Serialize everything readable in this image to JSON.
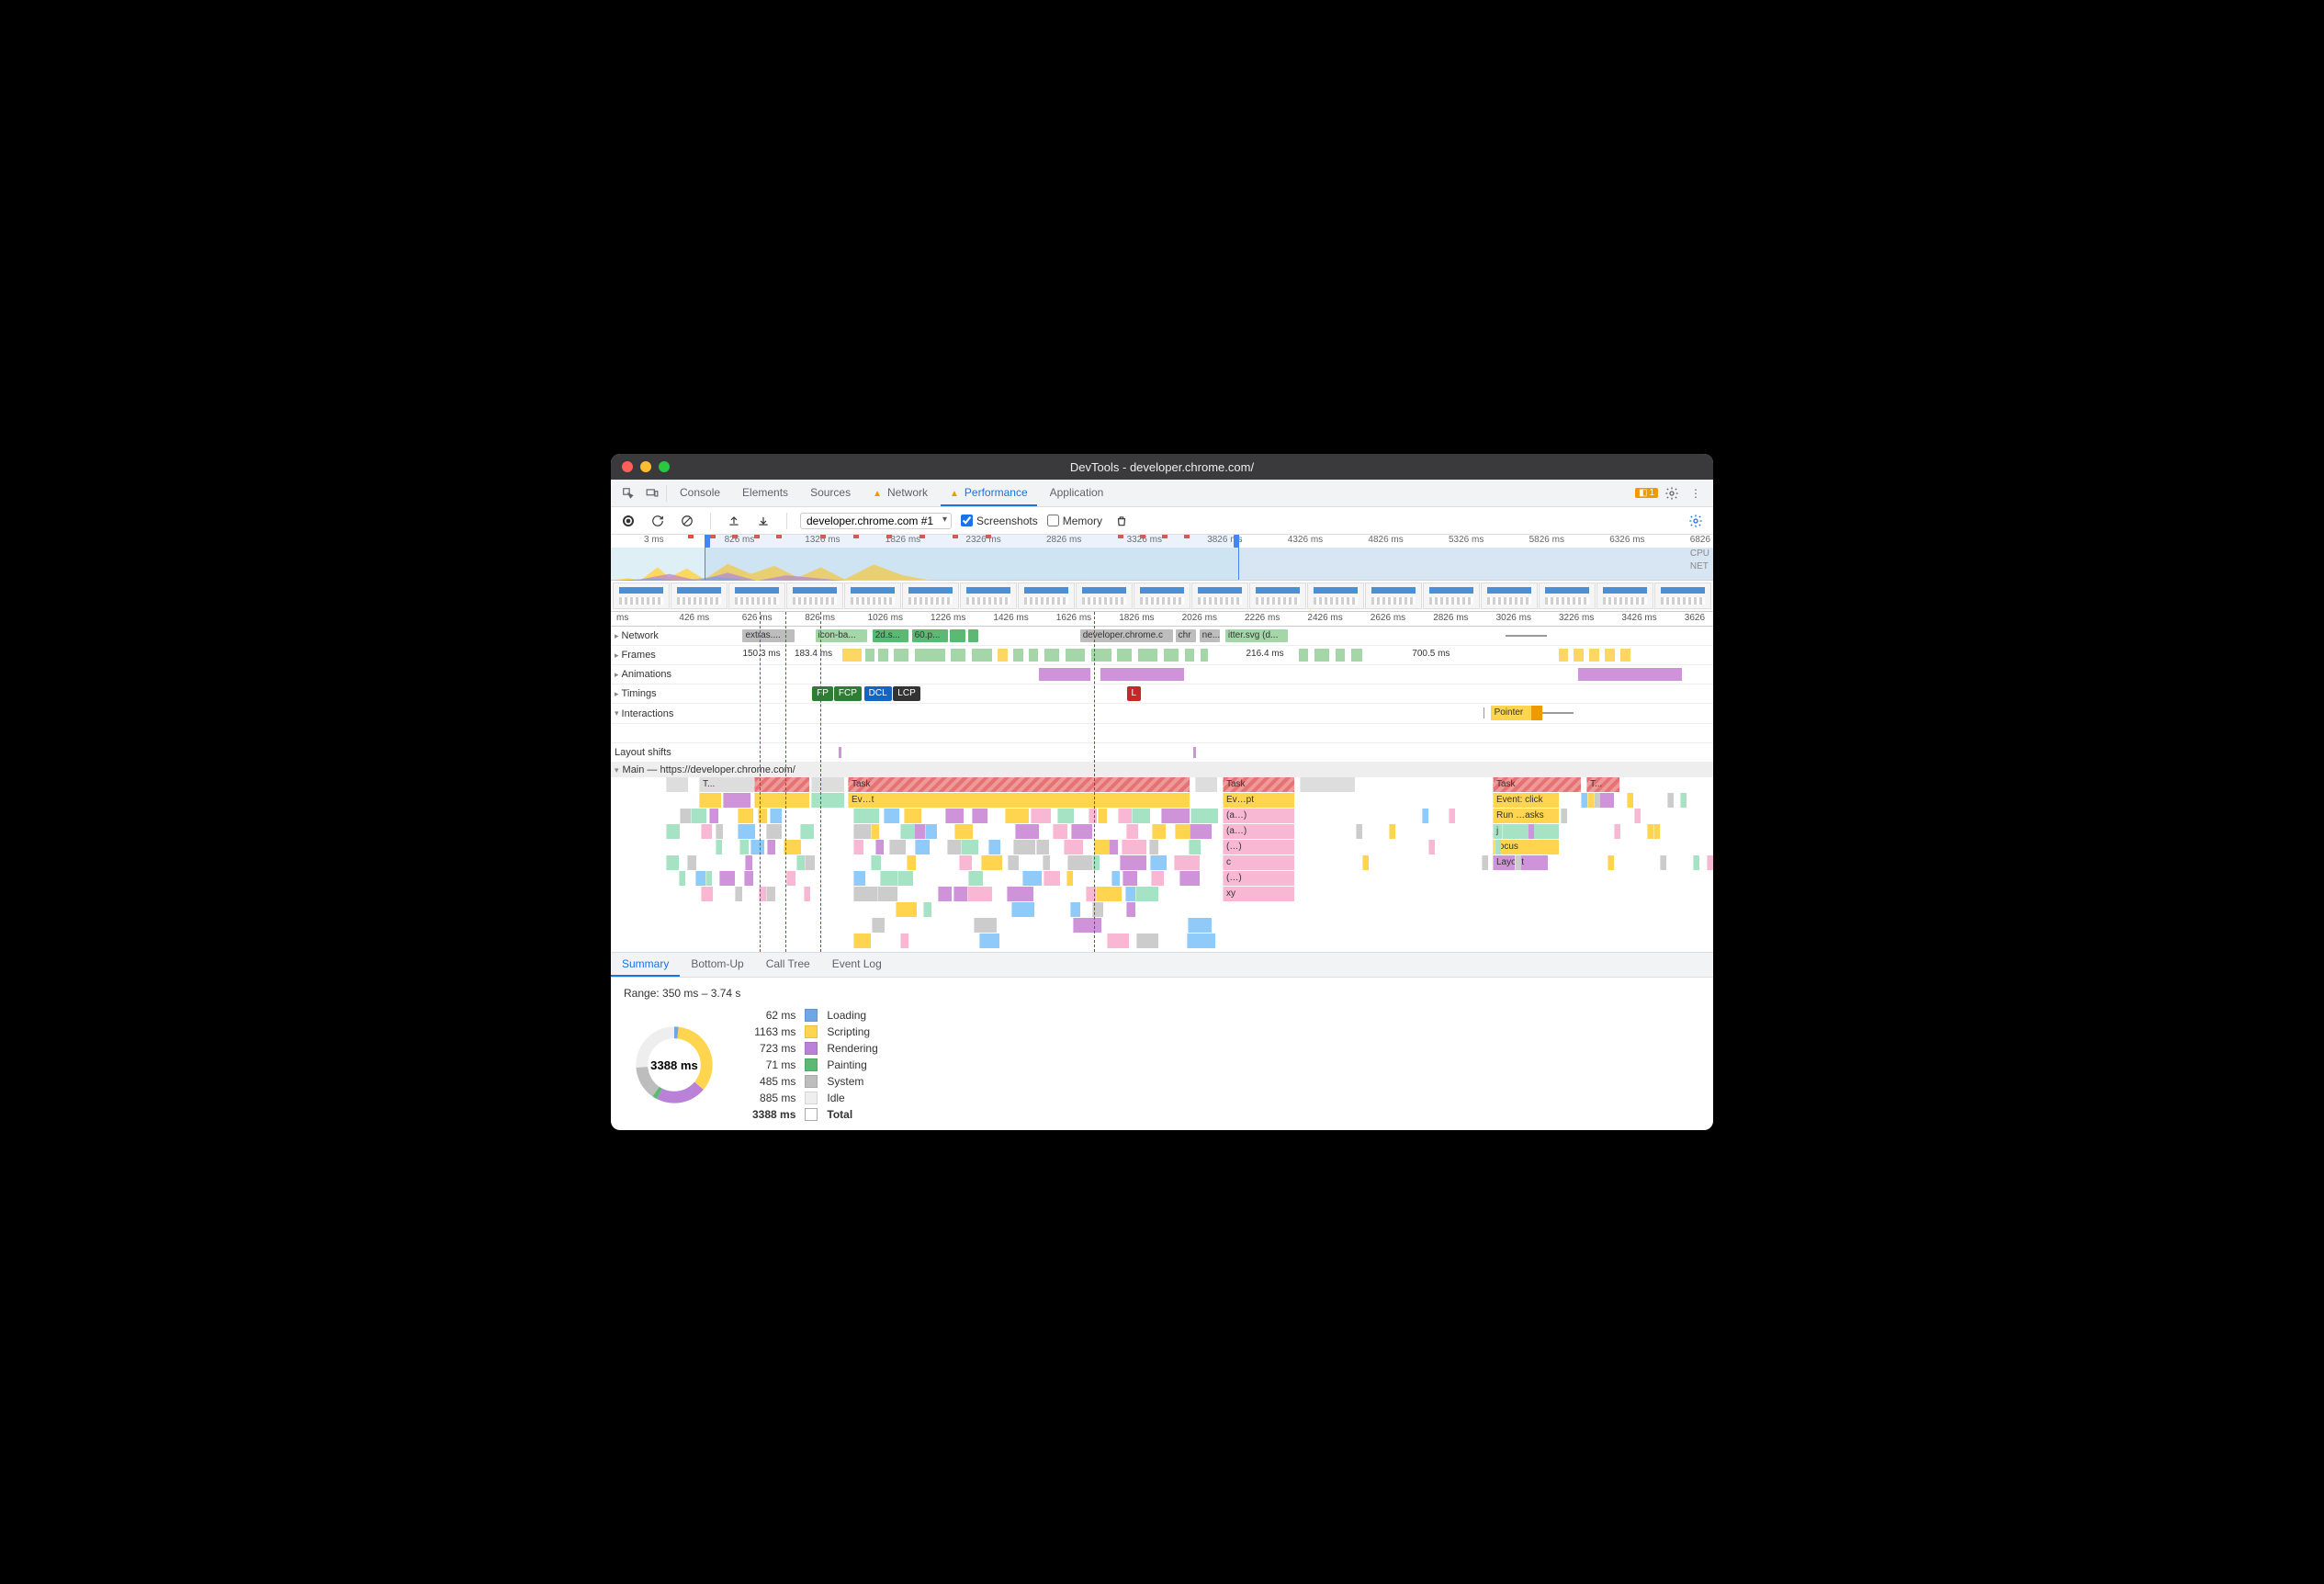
{
  "window": {
    "title": "DevTools - developer.chrome.com/"
  },
  "tabs": {
    "items": [
      "Console",
      "Elements",
      "Sources",
      "Network",
      "Performance",
      "Application"
    ],
    "active": 4,
    "warn_on": [
      3,
      4
    ],
    "right_badge": "1"
  },
  "toolbar": {
    "recording": "developer.chrome.com #1",
    "screenshots_label": "Screenshots",
    "screenshots_checked": true,
    "memory_label": "Memory",
    "memory_checked": false
  },
  "overview": {
    "ticks": [
      "3 ms",
      "826 ms",
      "1326 ms",
      "1826 ms",
      "2326 ms",
      "2826 ms",
      "3326 ms",
      "3826 ms",
      "4326 ms",
      "4826 ms",
      "5326 ms",
      "5826 ms",
      "6326 ms",
      "6826"
    ],
    "labels": [
      "CPU",
      "NET"
    ]
  },
  "ruler2_ticks": [
    "ms",
    "426 ms",
    "626 ms",
    "826 ms",
    "1026 ms",
    "1226 ms",
    "1426 ms",
    "1626 ms",
    "1826 ms",
    "2026 ms",
    "2226 ms",
    "2426 ms",
    "2626 ms",
    "2826 ms",
    "3026 ms",
    "3226 ms",
    "3426 ms",
    "3626"
  ],
  "tracks": {
    "network": "Network",
    "network_items": [
      {
        "l": "6.5%",
        "w": "5%",
        "bg": "#bdbdbd",
        "t": "extras...."
      },
      {
        "l": "13.5%",
        "w": "5%",
        "bg": "#a5d6a7",
        "t": "icon-ba..."
      },
      {
        "l": "19%",
        "w": "3.5%",
        "bg": "#5bb974",
        "t": "2d.s..."
      },
      {
        "l": "22.8%",
        "w": "3.5%",
        "bg": "#5bb974",
        "t": "60.p..."
      },
      {
        "l": "26.5%",
        "w": "1.5%",
        "bg": "#5bb974",
        "t": ""
      },
      {
        "l": "28.2%",
        "w": "1%",
        "bg": "#5bb974",
        "t": ""
      },
      {
        "l": "39%",
        "w": "9%",
        "bg": "#bdbdbd",
        "t": "developer.chrome.c"
      },
      {
        "l": "48.2%",
        "w": "2%",
        "bg": "#bdbdbd",
        "t": "chr"
      },
      {
        "l": "50.5%",
        "w": "2%",
        "bg": "#bdbdbd",
        "t": "ne..."
      },
      {
        "l": "53%",
        "w": "6%",
        "bg": "#a5d6a7",
        "t": "itter.svg (d..."
      }
    ],
    "frames": "Frames",
    "frame_times": [
      "150.3 ms",
      "183.4 ms",
      "216.4 ms",
      "700.5 ms"
    ],
    "animations": "Animations",
    "timings": "Timings",
    "timing_badges": [
      {
        "l": "13.2%",
        "bg": "#2e7d32",
        "t": "FP"
      },
      {
        "l": "15.3%",
        "bg": "#2e7d32",
        "t": "FCP"
      },
      {
        "l": "18.2%",
        "bg": "#1565c0",
        "t": "DCL"
      },
      {
        "l": "21%",
        "bg": "#333",
        "t": "LCP"
      },
      {
        "l": "43.5%",
        "bg": "#c62828",
        "t": "L"
      }
    ],
    "interactions": "Interactions",
    "pointer_label": "Pointer",
    "layout_shifts": "Layout shifts",
    "main": "Main — https://developer.chrome.com/",
    "main_tasks": {
      "t1": "T...",
      "task": "Task",
      "evt": "Ev…t",
      "evpt": "Ev…pt",
      "a": "(a…)",
      "dots": "(…)",
      "c": "c",
      "xy": "xy",
      "evc": "Event: click",
      "run": "Run …asks",
      "j": "j",
      "focus": "focus",
      "layout": "Layout"
    }
  },
  "bottom_tabs": {
    "items": [
      "Summary",
      "Bottom-Up",
      "Call Tree",
      "Event Log"
    ],
    "active": 0
  },
  "summary": {
    "range": "Range: 350 ms – 3.74 s",
    "total_label_center": "3388 ms",
    "rows": [
      {
        "ms": "62 ms",
        "color": "loading",
        "name": "Loading"
      },
      {
        "ms": "1163 ms",
        "color": "scripting",
        "name": "Scripting"
      },
      {
        "ms": "723 ms",
        "color": "rendering",
        "name": "Rendering"
      },
      {
        "ms": "71 ms",
        "color": "painting",
        "name": "Painting"
      },
      {
        "ms": "485 ms",
        "color": "system",
        "name": "System"
      },
      {
        "ms": "885 ms",
        "color": "idle",
        "name": "Idle"
      },
      {
        "ms": "3388 ms",
        "color": "total",
        "name": "Total"
      }
    ]
  },
  "chart_data": {
    "type": "pie",
    "title": "Range: 350 ms – 3.74 s",
    "series": [
      {
        "name": "Loading",
        "value": 62,
        "unit": "ms",
        "color": "#6ea6e6"
      },
      {
        "name": "Scripting",
        "value": 1163,
        "unit": "ms",
        "color": "#ffd54f"
      },
      {
        "name": "Rendering",
        "value": 723,
        "unit": "ms",
        "color": "#b982d8"
      },
      {
        "name": "Painting",
        "value": 71,
        "unit": "ms",
        "color": "#5bb974"
      },
      {
        "name": "System",
        "value": 485,
        "unit": "ms",
        "color": "#bdbdbd"
      },
      {
        "name": "Idle",
        "value": 885,
        "unit": "ms",
        "color": "#eeeeee"
      }
    ],
    "total": 3388
  }
}
